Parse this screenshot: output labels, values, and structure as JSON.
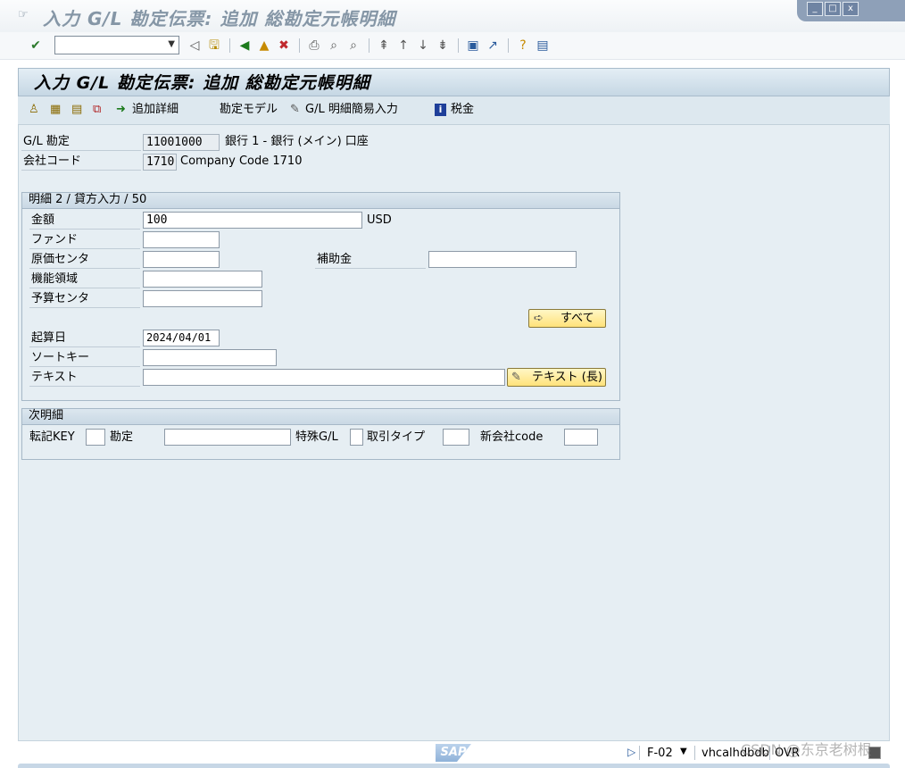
{
  "window": {
    "title": "入力 G/L 勘定伝票: 追加 総勘定元帳明細",
    "controls": [
      "_",
      "□",
      "x"
    ]
  },
  "toolbar": {
    "command_field": ""
  },
  "screen": {
    "title": "入力 G/L 勘定伝票: 追加 総勘定元帳明細"
  },
  "app_toolbar": {
    "add_details": "追加詳細",
    "account_model": "勘定モデル",
    "gl_fast_entry": "G/L 明細簡易入力",
    "tax": "税金"
  },
  "header_fields": {
    "gl_account_label": "G/L 勘定",
    "gl_account_value": "11001000",
    "gl_account_desc": "銀行 1 - 銀行 (メイン) 口座",
    "company_code_label": "会社コード",
    "company_code_value": "1710",
    "company_code_desc": "Company Code 1710"
  },
  "item": {
    "group_title": "明細 2 / 貸方入力 / 50",
    "amount_label": "金額",
    "amount_value": "100",
    "currency": "USD",
    "fund_label": "ファンド",
    "cost_center_label": "原価センタ",
    "grant_label": "補助金",
    "functional_area_label": "機能領域",
    "budget_center_label": "予算センタ",
    "all_button": "すべて",
    "value_date_label": "起算日",
    "value_date_value": "2024/04/01",
    "sort_key_label": "ソートキー",
    "text_label": "テキスト",
    "long_text_button": "テキスト (長)"
  },
  "next_item": {
    "group_title": "次明細",
    "posting_key_label": "転記KEY",
    "account_label": "勘定",
    "special_gl_label": "特殊G/L",
    "trans_type_label": "取引タイプ",
    "new_company_label": "新会社code"
  },
  "status_bar": {
    "logo": "SAP",
    "transaction": "F-02",
    "server": "vhcalhdbdb",
    "mode": "OVR"
  },
  "watermark": "CSDN @东京老树根",
  "colors": {
    "background": "#e6eef3",
    "button_yellow": "#ffe27a",
    "title_gray": "#8596a6"
  }
}
